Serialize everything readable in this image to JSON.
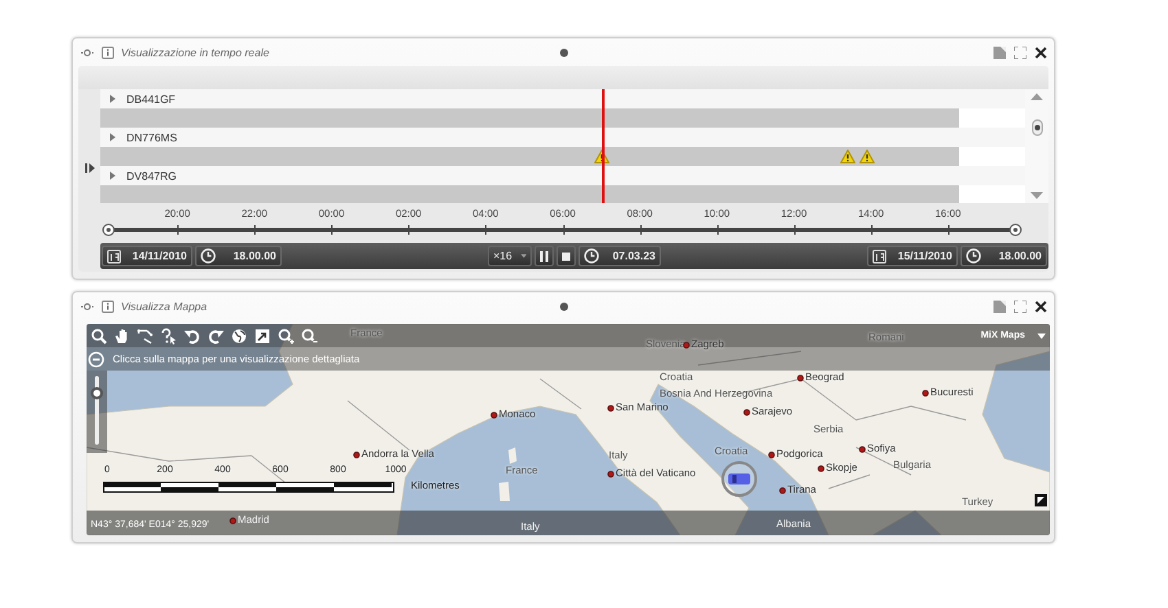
{
  "timeline_panel": {
    "title": "Visualizzazione in tempo reale",
    "vehicles": [
      {
        "plate": "DB441GF",
        "expanded": false
      },
      {
        "plate": "DN776MS",
        "expanded": false,
        "alerts": [
          {
            "kind": "warning"
          },
          {
            "kind": "warning"
          },
          {
            "kind": "warning"
          }
        ]
      },
      {
        "plate": "DV847RG",
        "expanded": false
      }
    ],
    "range_handles": [
      {
        "level": 0
      },
      {
        "level": 1
      }
    ],
    "axis_labels": [
      "20:00",
      "22:00",
      "00:00",
      "02:00",
      "04:00",
      "06:00",
      "08:00",
      "10:00",
      "12:00",
      "14:00",
      "16:00"
    ],
    "start": {
      "date": "14/11/2010",
      "time": "18.00.00"
    },
    "speed": "×16",
    "current_time": "07.03.23",
    "end": {
      "date": "15/11/2010",
      "time": "18.00.00"
    }
  },
  "map_panel": {
    "title": "Visualizza Mappa",
    "brand": "MiX Maps",
    "hint": "Clicca sulla mappa per una visualizzazione dettagliata",
    "zoom": {
      "level": 0.8
    },
    "places": [
      {
        "name": "France",
        "kind": "country"
      },
      {
        "name": "Slovenia",
        "kind": "country"
      },
      {
        "name": "Zagreb",
        "kind": "city"
      },
      {
        "name": "Romani",
        "kind": "country"
      },
      {
        "name": "Croatia",
        "kind": "country"
      },
      {
        "name": "Beograd",
        "kind": "city"
      },
      {
        "name": "Bosnia And Herzegovina",
        "kind": "country"
      },
      {
        "name": "Bucuresti",
        "kind": "city"
      },
      {
        "name": "Monaco",
        "kind": "city"
      },
      {
        "name": "San Marino",
        "kind": "city"
      },
      {
        "name": "Sarajevo",
        "kind": "city"
      },
      {
        "name": "Serbia",
        "kind": "country"
      },
      {
        "name": "Andorra la Vella",
        "kind": "city"
      },
      {
        "name": "Italy",
        "kind": "country"
      },
      {
        "name": "Croatia",
        "kind": "country"
      },
      {
        "name": "Podgorica",
        "kind": "city"
      },
      {
        "name": "Sofiya",
        "kind": "city"
      },
      {
        "name": "Bulgaria",
        "kind": "country"
      },
      {
        "name": "France",
        "kind": "country"
      },
      {
        "name": "Città del Vaticano",
        "kind": "city"
      },
      {
        "name": "Skopje",
        "kind": "city"
      },
      {
        "name": "Tirana",
        "kind": "city"
      },
      {
        "name": "Turkey",
        "kind": "country"
      },
      {
        "name": "Madrid",
        "kind": "city"
      },
      {
        "name": "Italy",
        "kind": "country"
      },
      {
        "name": "Albania",
        "kind": "country"
      }
    ],
    "scale": {
      "ticks": [
        "0",
        "200",
        "400",
        "600",
        "800",
        "1000"
      ],
      "unit": "Kilometres"
    },
    "coordinates": "N43° 37,684' E014° 25,929'"
  }
}
